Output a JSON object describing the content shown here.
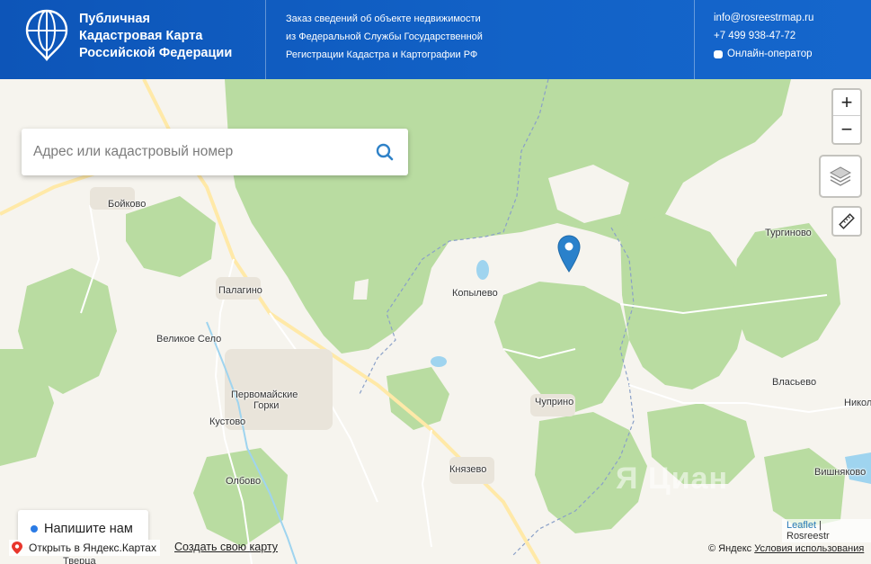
{
  "header": {
    "title_lines": [
      "Публичная",
      "Кадастровая Карта",
      "Российской Федерации"
    ],
    "info_lines": [
      "Заказ сведений об объекте недвижимости",
      "из Федеральной Службы Государственной",
      "Регистрации Кадастра и Картографии РФ"
    ],
    "email": "info@rosreestrmap.ru",
    "phone": "+7 499 938-47-72",
    "operator": "Онлайн-оператор"
  },
  "search": {
    "placeholder": "Адрес или кадастровый номер"
  },
  "controls": {
    "zoom_in": "+",
    "zoom_out": "−"
  },
  "places": [
    "Бойково",
    "Палагино",
    "Великое Село",
    "Первомайские",
    "Горки",
    "Кустово",
    "Олбово",
    "Копылево",
    "Чуприно",
    "Князево",
    "Тургиново",
    "Власьево",
    "Никол",
    "Вишняково",
    "Тверца"
  ],
  "watermark": "Я Циан",
  "attribution": {
    "leaflet": "Leaflet",
    "separator": " | ",
    "source": "Rosreestr"
  },
  "chat": {
    "label": "Напишите нам"
  },
  "yandex": {
    "open_label": "Открыть в Яндекс.Картах",
    "create_label": "Создать свою карту",
    "copyright": "© Яндекс",
    "terms": "Условия использования"
  },
  "colors": {
    "header": "#1262c7",
    "forest": "#b9dca1",
    "field": "#f6f4ee",
    "water": "#9fd4ef",
    "marker": "#2a81cb"
  }
}
